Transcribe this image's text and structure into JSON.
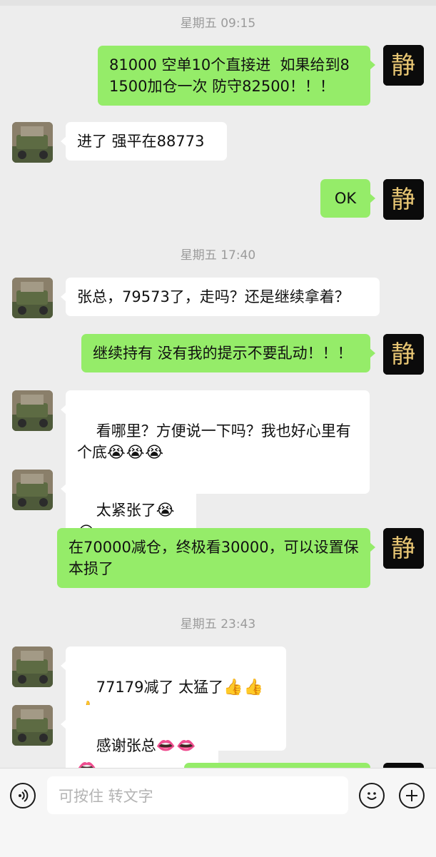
{
  "timestamps": [
    "星期五 09:15",
    "星期五 17:40",
    "星期五 23:43"
  ],
  "messages": [
    {
      "sender": "me",
      "text": "81000 空单10个直接进  如果给到81500加仓一次 防守82500！！！"
    },
    {
      "sender": "them",
      "text": "进了 强平在88773"
    },
    {
      "sender": "me",
      "text": "OK"
    },
    {
      "sender": "them",
      "text": "张总，79573了，走吗？还是继续拿着？"
    },
    {
      "sender": "me",
      "text": "继续持有 没有我的提示不要乱动！！！"
    },
    {
      "sender": "them",
      "text": "看哪里？方便说一下吗？我也好心里有个底",
      "emoji": "😭😭😭"
    },
    {
      "sender": "them",
      "text": "太紧张了",
      "emoji": "😭😭"
    },
    {
      "sender": "me",
      "text": "在70000减仓，终极看30000，可以设置保本损了"
    },
    {
      "sender": "them",
      "text": "77179减了 太猛了",
      "emoji": "👍👍👍"
    },
    {
      "sender": "them",
      "text": "感谢张总",
      "emoji": "👄👄👄"
    }
  ],
  "me_avatar_glyph": "静",
  "input": {
    "placeholder": "可按住 转文字"
  },
  "icons": {
    "voice": "voice-icon",
    "emoji": "emoji-icon",
    "add": "plus-icon"
  },
  "colors": {
    "me_bubble": "#95ec69",
    "them_bubble": "#ffffff",
    "background": "#ededed",
    "timestamp": "#9b9b9b"
  }
}
